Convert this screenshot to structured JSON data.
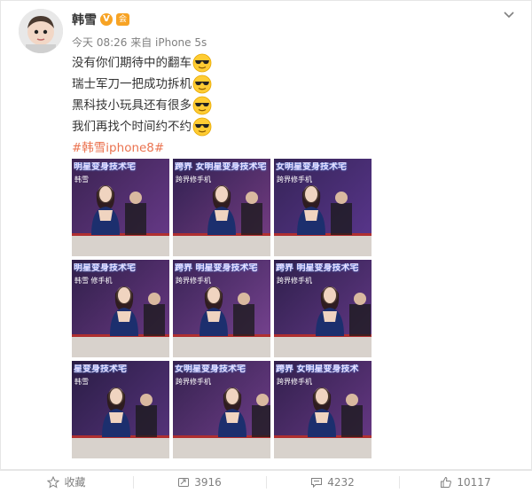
{
  "post": {
    "author": "韩雪",
    "verified_badge": "V",
    "member_badge": "会",
    "meta": "今天 08:26 来自 iPhone 5s",
    "lines": [
      {
        "text": "没有你们期待中的翻车",
        "emoji": "cool-emoji"
      },
      {
        "text": "瑞士军刀一把成功拆机",
        "emoji": "cool-emoji"
      },
      {
        "text": "黑科技小玩具还有很多",
        "emoji": "cool-emoji"
      },
      {
        "text": "我们再找个时间约不约",
        "emoji": "cool-emoji"
      }
    ],
    "topic": "#韩雪iphone8#",
    "photos": [
      {
        "banner": "明星变身技术宅",
        "sub": "韩雪"
      },
      {
        "banner": "跨界 女明星变身技术宅",
        "sub": "跨界修手机"
      },
      {
        "banner": "女明星变身技术宅",
        "sub": "跨界修手机"
      },
      {
        "banner": "明星变身技术宅",
        "sub": "韩雪 修手机"
      },
      {
        "banner": "跨界 明星变身技术宅",
        "sub": "跨界修手机"
      },
      {
        "banner": "跨界 明星变身技术宅",
        "sub": "跨界修手机"
      },
      {
        "banner": "星变身技术宅",
        "sub": "韩雪"
      },
      {
        "banner": "女明星变身技术宅",
        "sub": "跨界修手机"
      },
      {
        "banner": "跨界 女明星变身技术",
        "sub": "跨界修手机"
      }
    ]
  },
  "footer": {
    "favorite": "收藏",
    "repost": "3916",
    "comment": "4232",
    "like": "10117"
  },
  "colors": {
    "accent": "#f7a324",
    "topic": "#eb7350",
    "meta": "#808080"
  }
}
